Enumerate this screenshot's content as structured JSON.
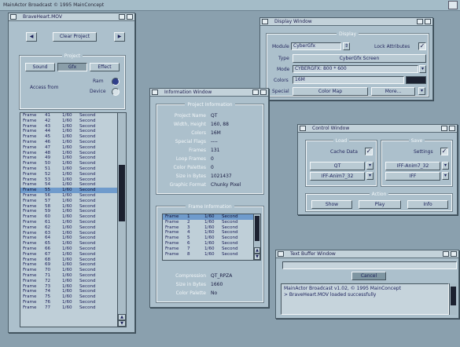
{
  "topbar": {
    "title": "MainActor Broadcast © 1995 MainConcept"
  },
  "project_window": {
    "title": "BraveHeart.MOV",
    "clear_project": "Clear Project",
    "group": "Project",
    "tabs": [
      "Sound",
      "Gfx",
      "Effect"
    ],
    "active_tab": "Gfx",
    "access_label": "Access from",
    "options": [
      "Ram",
      "Device"
    ],
    "frames": [
      {
        "name": "Frame",
        "num": "41",
        "t": "1/60",
        "unit": "Second"
      },
      {
        "name": "Frame",
        "num": "42",
        "t": "1/60",
        "unit": "Second"
      },
      {
        "name": "Frame",
        "num": "43",
        "t": "1/60",
        "unit": "Second"
      },
      {
        "name": "Frame",
        "num": "44",
        "t": "1/60",
        "unit": "Second"
      },
      {
        "name": "Frame",
        "num": "45",
        "t": "1/60",
        "unit": "Second"
      },
      {
        "name": "Frame",
        "num": "46",
        "t": "1/60",
        "unit": "Second"
      },
      {
        "name": "Frame",
        "num": "47",
        "t": "1/60",
        "unit": "Second"
      },
      {
        "name": "Frame",
        "num": "48",
        "t": "1/60",
        "unit": "Second"
      },
      {
        "name": "Frame",
        "num": "49",
        "t": "1/60",
        "unit": "Second"
      },
      {
        "name": "Frame",
        "num": "50",
        "t": "1/60",
        "unit": "Second"
      },
      {
        "name": "Frame",
        "num": "51",
        "t": "1/60",
        "unit": "Second"
      },
      {
        "name": "Frame",
        "num": "52",
        "t": "1/60",
        "unit": "Second"
      },
      {
        "name": "Frame",
        "num": "53",
        "t": "1/60",
        "unit": "Second"
      },
      {
        "name": "Frame",
        "num": "54",
        "t": "1/60",
        "unit": "Second"
      },
      {
        "name": "Frame",
        "num": "55",
        "t": "1/60",
        "unit": "Second"
      },
      {
        "name": "Frame",
        "num": "56",
        "t": "1/60",
        "unit": "Second"
      },
      {
        "name": "Frame",
        "num": "57",
        "t": "1/60",
        "unit": "Second"
      },
      {
        "name": "Frame",
        "num": "58",
        "t": "1/60",
        "unit": "Second"
      },
      {
        "name": "Frame",
        "num": "59",
        "t": "1/60",
        "unit": "Second"
      },
      {
        "name": "Frame",
        "num": "60",
        "t": "1/60",
        "unit": "Second"
      },
      {
        "name": "Frame",
        "num": "61",
        "t": "1/60",
        "unit": "Second"
      },
      {
        "name": "Frame",
        "num": "62",
        "t": "1/60",
        "unit": "Second"
      },
      {
        "name": "Frame",
        "num": "63",
        "t": "1/60",
        "unit": "Second"
      },
      {
        "name": "Frame",
        "num": "64",
        "t": "1/60",
        "unit": "Second"
      },
      {
        "name": "Frame",
        "num": "65",
        "t": "1/60",
        "unit": "Second"
      },
      {
        "name": "Frame",
        "num": "66",
        "t": "1/60",
        "unit": "Second"
      },
      {
        "name": "Frame",
        "num": "67",
        "t": "1/60",
        "unit": "Second"
      },
      {
        "name": "Frame",
        "num": "68",
        "t": "1/60",
        "unit": "Second"
      },
      {
        "name": "Frame",
        "num": "69",
        "t": "1/60",
        "unit": "Second"
      },
      {
        "name": "Frame",
        "num": "70",
        "t": "1/60",
        "unit": "Second"
      },
      {
        "name": "Frame",
        "num": "71",
        "t": "1/60",
        "unit": "Second"
      },
      {
        "name": "Frame",
        "num": "72",
        "t": "1/60",
        "unit": "Second"
      },
      {
        "name": "Frame",
        "num": "73",
        "t": "1/60",
        "unit": "Second"
      },
      {
        "name": "Frame",
        "num": "74",
        "t": "1/60",
        "unit": "Second"
      },
      {
        "name": "Frame",
        "num": "75",
        "t": "1/60",
        "unit": "Second"
      },
      {
        "name": "Frame",
        "num": "76",
        "t": "1/60",
        "unit": "Second"
      },
      {
        "name": "Frame",
        "num": "77",
        "t": "1/60",
        "unit": "Second"
      }
    ],
    "selected_frame": "55"
  },
  "info_window": {
    "title": "Information Window",
    "project_group": "Project Information",
    "fields": [
      {
        "label": "Project Name",
        "value": "QT"
      },
      {
        "label": "Width, Height",
        "value": "160, 88"
      },
      {
        "label": "Colors",
        "value": "16M"
      },
      {
        "label": "Special Flags",
        "value": "----"
      },
      {
        "label": "Frames",
        "value": "131"
      },
      {
        "label": "Loop Frames",
        "value": "0"
      },
      {
        "label": "Color Palettes",
        "value": "0"
      },
      {
        "label": "Size in Bytes",
        "value": "1021437"
      },
      {
        "label": "Graphic Format",
        "value": "Chunky Pixel"
      }
    ],
    "frame_group": "Frame Information",
    "frames": [
      {
        "name": "Frame",
        "num": "1",
        "t": "1/60",
        "unit": "Second"
      },
      {
        "name": "Frame",
        "num": "2",
        "t": "1/60",
        "unit": "Second"
      },
      {
        "name": "Frame",
        "num": "3",
        "t": "1/60",
        "unit": "Second"
      },
      {
        "name": "Frame",
        "num": "4",
        "t": "1/60",
        "unit": "Second"
      },
      {
        "name": "Frame",
        "num": "5",
        "t": "1/60",
        "unit": "Second"
      },
      {
        "name": "Frame",
        "num": "6",
        "t": "1/60",
        "unit": "Second"
      },
      {
        "name": "Frame",
        "num": "7",
        "t": "1/60",
        "unit": "Second"
      },
      {
        "name": "Frame",
        "num": "8",
        "t": "1/60",
        "unit": "Second"
      }
    ],
    "frame_fields": [
      {
        "label": "Compression",
        "value": "QT_RPZA"
      },
      {
        "label": "Size in Bytes",
        "value": "1660"
      },
      {
        "label": "Color Palette",
        "value": "No"
      }
    ]
  },
  "display_window": {
    "title": "Display Window",
    "group": "Display",
    "module_label": "Module",
    "module_value": "CyberGfx",
    "lock_label": "Lock Attributes",
    "type_label": "Type",
    "type_value": "CyberGfx Screen",
    "mode_label": "Mode",
    "mode_value": "CYBERGFX: 800 * 600",
    "colors_label": "Colors",
    "colors_value": "16M",
    "special_label": "Special",
    "special_value": "Color Map",
    "more_label": "More..."
  },
  "control_window": {
    "title": "Control Window",
    "load_group": "Load",
    "save_group": "Save",
    "cache_data": "Cache Data",
    "settings": "Settings",
    "load_format1": "QT",
    "load_format2": "IFF-Anim7_32",
    "save_format1": "IFF-Anim7_32",
    "save_format2": "IFF",
    "action_group": "Action",
    "actions": [
      "Show",
      "Play",
      "Info"
    ]
  },
  "text_window": {
    "title": "Text Buffer Window",
    "cancel": "Cancel",
    "lines": [
      "MainActor Broadcast v1.02, © 1995 MainConcept",
      "> BraveHeart.MOV loaded successfully"
    ]
  }
}
